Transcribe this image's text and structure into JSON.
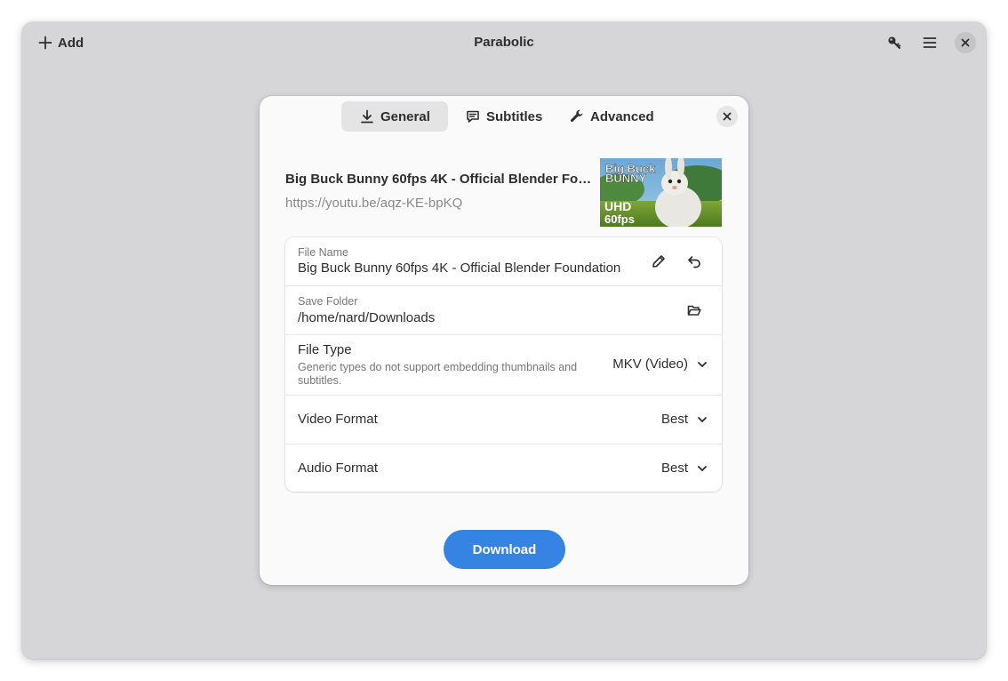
{
  "window": {
    "title": "Parabolic",
    "add_label": "Add"
  },
  "icons": {
    "add": "plus-icon",
    "keyring": "key-icon",
    "menu": "hamburger-menu-icon",
    "close": "close-icon"
  },
  "dialog": {
    "tabs": [
      {
        "label": "General",
        "icon": "download-icon",
        "active": true
      },
      {
        "label": "Subtitles",
        "icon": "subtitles-icon",
        "active": false
      },
      {
        "label": "Advanced",
        "icon": "wrench-icon",
        "active": false
      }
    ],
    "media": {
      "title": "Big Buck Bunny 60fps 4K - Official Blender Foundation",
      "url": "https://youtu.be/aqz-KE-bpKQ",
      "thumbnail_text": {
        "line1": "Big Buck",
        "line2": "BUNNY",
        "line3": "UHD",
        "line4": "60fps"
      }
    },
    "fields": {
      "file_name": {
        "label": "File Name",
        "value": "Big Buck Bunny 60fps 4K - Official Blender Foundation"
      },
      "save_folder": {
        "label": "Save Folder",
        "value": "/home/nard/Downloads"
      },
      "file_type": {
        "label": "File Type",
        "description": "Generic types do not support embedding thumbnails and subtitles.",
        "selected": "MKV (Video)"
      },
      "video_format": {
        "label": "Video Format",
        "selected": "Best"
      },
      "audio_format": {
        "label": "Audio Format",
        "selected": "Best"
      }
    },
    "download_label": "Download"
  },
  "colors": {
    "accent": "#3584e4",
    "window_bg": "#d6d6d8",
    "dialog_bg": "#fafafa"
  }
}
